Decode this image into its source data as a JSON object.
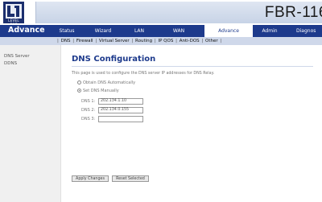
{
  "header": {
    "logo_text": "LEVEL ONE",
    "model": "FBR-116"
  },
  "nav": {
    "section": "Advance",
    "tabs": [
      {
        "label": "Status",
        "active": false
      },
      {
        "label": "Wizard",
        "active": false
      },
      {
        "label": "LAN",
        "active": false
      },
      {
        "label": "WAN",
        "active": false
      },
      {
        "label": "Advance",
        "active": true
      },
      {
        "label": "Admin",
        "active": false
      },
      {
        "label": "Diagnos",
        "active": false
      }
    ]
  },
  "subnav": {
    "items": [
      "DNS",
      "Firewall",
      "Virtual Server",
      "Routing",
      "IP QOS",
      "Anti-DOS",
      "Other"
    ]
  },
  "sidebar": {
    "items": [
      "DNS Server",
      "DDNS"
    ]
  },
  "content": {
    "title": "DNS Configuration",
    "description": "This page is used to configure the DNS server IP addresses for DNS Relay.",
    "radio_auto": "Obtain DNS Automatically",
    "radio_manual": "Set DNS Manually",
    "dns1_label": "DNS 1:",
    "dns1_value": "202.134.1.10",
    "dns2_label": "DNS 2:",
    "dns2_value": "202.134.0.155",
    "dns3_label": "DNS 3:",
    "dns3_value": "",
    "apply_label": "Apply Changes",
    "reset_label": "Reset Selected"
  }
}
